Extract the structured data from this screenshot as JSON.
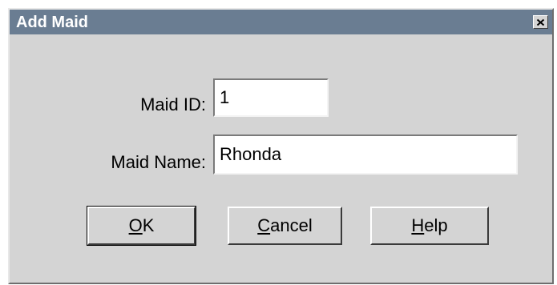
{
  "window": {
    "title": "Add Maid",
    "close_icon": "close-icon"
  },
  "form": {
    "maid_id_label": "Maid ID:",
    "maid_id_value": "1",
    "maid_name_label": "Maid Name:",
    "maid_name_value": "Rhonda"
  },
  "buttons": {
    "ok": {
      "mnemonic": "O",
      "rest": "K"
    },
    "cancel": {
      "mnemonic": "C",
      "rest": "ancel"
    },
    "help": {
      "mnemonic": "H",
      "rest": "elp"
    }
  },
  "colors": {
    "titlebar": "#6a7d92",
    "dialog_face": "#d4d4d4"
  }
}
